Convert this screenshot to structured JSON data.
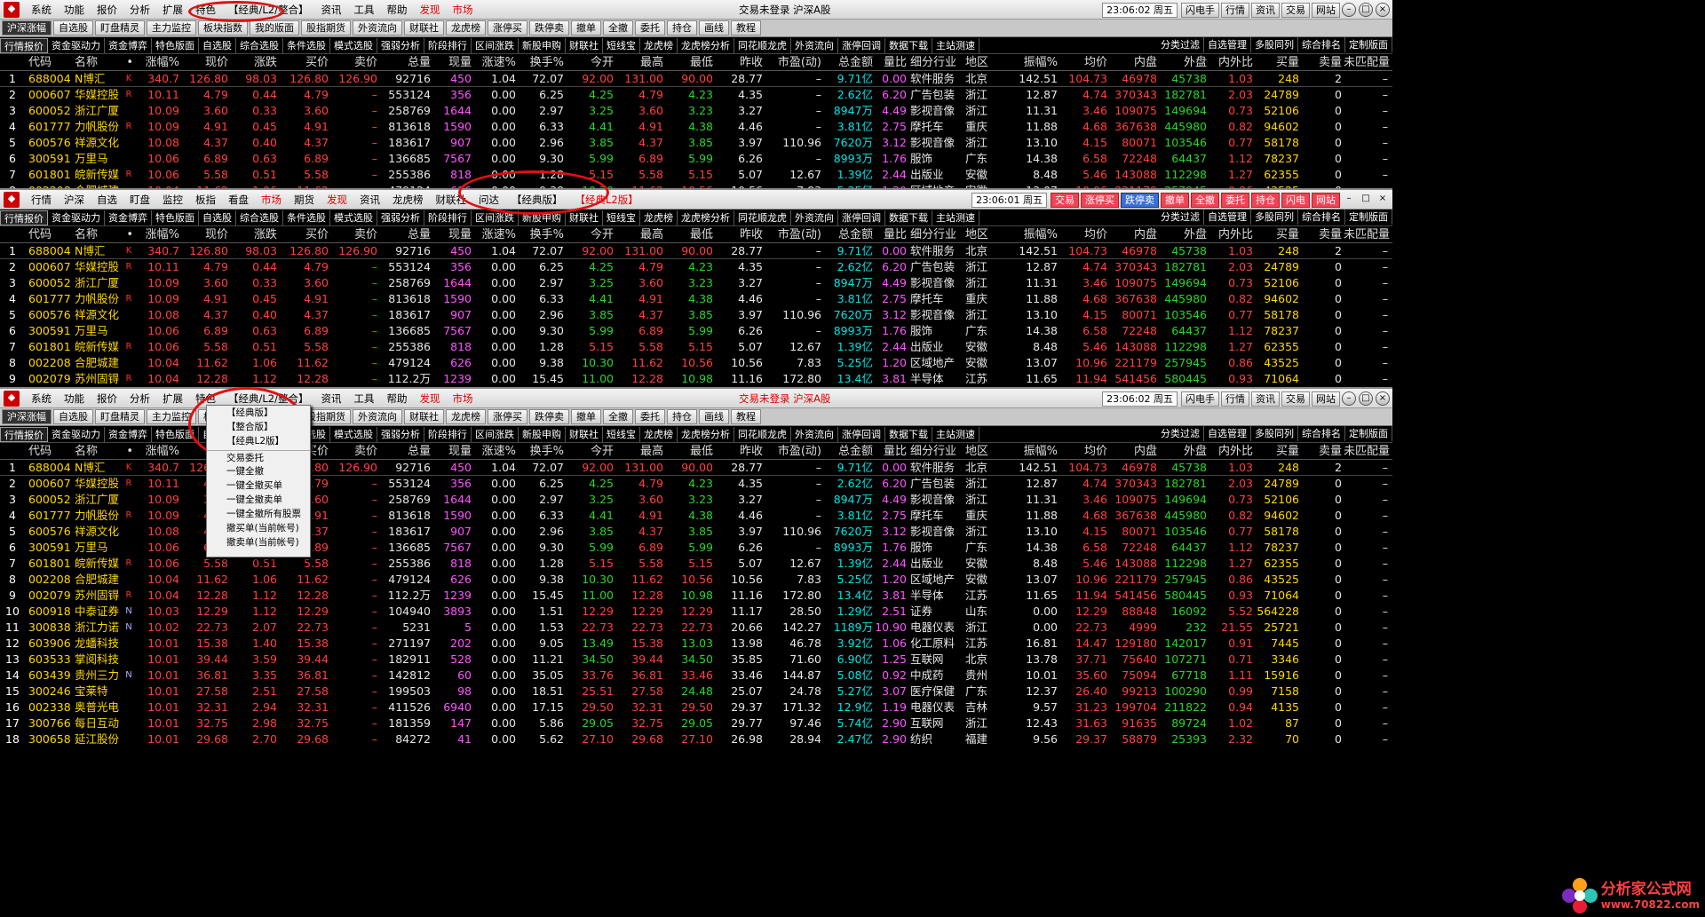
{
  "menu1": {
    "items": [
      "系统",
      "功能",
      "报价",
      "分析",
      "扩展",
      "特色",
      "【经典/L2/整合】",
      "资讯",
      "工具",
      "帮助",
      "发现",
      "市场"
    ],
    "status": "交易未登录  沪深A股",
    "clock": "23:06:02 周五",
    "right_buttons": [
      "闪电手",
      "行情",
      "资讯",
      "交易",
      "网站"
    ]
  },
  "toolbar1": [
    "沪深涨幅",
    "自选股",
    "盯盘精灵",
    "主力监控",
    "板块指数",
    "我的版面",
    "股指期货",
    "外资流向",
    "财联社",
    "龙虎榜",
    "涨停买",
    "跌停卖",
    "撤单",
    "全撤",
    "委托",
    "持仓",
    "画线",
    "教程"
  ],
  "subtabs": [
    "行情报价",
    "资金驱动力",
    "资金博弈",
    "特色版面",
    "自选股",
    "综合选股",
    "条件选股",
    "模式选股",
    "强弱分析",
    "阶段排行",
    "区间涨跌",
    "新股申购",
    "财联社",
    "短线宝",
    "龙虎榜",
    "龙虎榜分析",
    "同花顺龙虎",
    "外资流向",
    "涨停回调",
    "数据下载",
    "主站测速"
  ],
  "subtabs_right": [
    "分类过滤",
    "自选管理",
    "多股同列",
    "综合排名",
    "定制版面"
  ],
  "menu2": {
    "items": [
      "行情",
      "沪深",
      "自选",
      "盯盘",
      "监控",
      "板指",
      "看盘",
      "市场",
      "期货",
      "发现",
      "资讯",
      "龙虎榜",
      "财联社",
      "问达",
      "【经典版】",
      "【经典L2版】"
    ],
    "clock": "23:06:01 周五",
    "right_buttons": [
      "交易",
      "涨停买",
      "跌停卖",
      "撤单",
      "全撤",
      "委托",
      "持仓",
      "闪电",
      "网站"
    ]
  },
  "toolbar3": [
    "沪深涨幅",
    "自选股",
    "盯盘精灵",
    "主力监控",
    "板块指数",
    "我的版面",
    "股指期货",
    "外资流向",
    "财联社",
    "龙虎榜",
    "涨停买",
    "跌停卖",
    "撤单",
    "全撤",
    "委托",
    "持仓",
    "画线",
    "教程"
  ],
  "dropdown": {
    "items": [
      "【经典版】",
      "【整合版】",
      "【经典L2版】",
      "交易委托",
      "一键全撤",
      "一键全撤买单",
      "一键全撤卖单",
      "一键全撤所有股票",
      "撤买单(当前帐号)",
      "撤卖单(当前帐号)"
    ]
  },
  "table": {
    "headers": [
      "",
      "代码",
      "名称",
      "•",
      "涨幅%",
      "现价",
      "涨跌",
      "买价",
      "卖价",
      "总量",
      "现量",
      "涨速%",
      "换手%",
      "今开",
      "最高",
      "最低",
      "昨收",
      "市盈(动)",
      "总金额",
      "量比",
      "细分行业",
      "地区",
      "振幅%",
      "均价",
      "内盘",
      "外盘",
      "内外比",
      "买量",
      "卖量",
      "未匹配量"
    ],
    "rows": [
      [
        "1",
        "688004",
        "N博汇",
        "K",
        "340.7",
        "126.80",
        "98.03",
        "126.80",
        "126.90",
        "92716",
        "450",
        "1.04",
        "72.07",
        "92.00",
        "131.00",
        "90.00",
        "28.77",
        "–",
        "9.71亿",
        "0.00",
        "软件服务",
        "北京",
        "142.51",
        "104.73",
        "46978",
        "45738",
        "1.03",
        "248",
        "2",
        "–"
      ],
      [
        "2",
        "000607",
        "华媒控股",
        "R",
        "10.11",
        "4.79",
        "0.44",
        "4.79",
        "–",
        "553124",
        "356",
        "0.00",
        "6.25",
        "4.25",
        "4.79",
        "4.23",
        "4.35",
        "–",
        "2.62亿",
        "6.20",
        "广告包装",
        "浙江",
        "12.87",
        "4.74",
        "370343",
        "182781",
        "2.03",
        "24789",
        "0",
        "–"
      ],
      [
        "3",
        "600052",
        "浙江广厦",
        "",
        "10.09",
        "3.60",
        "0.33",
        "3.60",
        "–",
        "258769",
        "1644",
        "0.00",
        "2.97",
        "3.25",
        "3.60",
        "3.23",
        "3.27",
        "–",
        "8947万",
        "4.49",
        "影视音像",
        "浙江",
        "11.31",
        "3.46",
        "109075",
        "149694",
        "0.73",
        "52106",
        "0",
        "–"
      ],
      [
        "4",
        "601777",
        "力帆股份",
        "R",
        "10.09",
        "4.91",
        "0.45",
        "4.91",
        "–",
        "813618",
        "1590",
        "0.00",
        "6.33",
        "4.41",
        "4.91",
        "4.38",
        "4.46",
        "–",
        "3.81亿",
        "2.75",
        "摩托车",
        "重庆",
        "11.88",
        "4.68",
        "367638",
        "445980",
        "0.82",
        "94602",
        "0",
        "–"
      ],
      [
        "5",
        "600576",
        "祥源文化",
        "",
        "10.08",
        "4.37",
        "0.40",
        "4.37",
        "–",
        "183617",
        "907",
        "0.00",
        "2.96",
        "3.85",
        "4.37",
        "3.85",
        "3.97",
        "110.96",
        "7620万",
        "3.12",
        "影视音像",
        "浙江",
        "13.10",
        "4.15",
        "80071",
        "103546",
        "0.77",
        "58178",
        "0",
        "–"
      ],
      [
        "6",
        "300591",
        "万里马",
        "",
        "10.06",
        "6.89",
        "0.63",
        "6.89",
        "–",
        "136685",
        "7567",
        "0.00",
        "9.30",
        "5.99",
        "6.89",
        "5.99",
        "6.26",
        "–",
        "8993万",
        "1.76",
        "服饰",
        "广东",
        "14.38",
        "6.58",
        "72248",
        "64437",
        "1.12",
        "78237",
        "0",
        "–"
      ],
      [
        "7",
        "601801",
        "皖新传媒",
        "R",
        "10.06",
        "5.58",
        "0.51",
        "5.58",
        "–",
        "255386",
        "818",
        "0.00",
        "1.28",
        "5.15",
        "5.58",
        "5.15",
        "5.07",
        "12.67",
        "1.39亿",
        "2.44",
        "出版业",
        "安徽",
        "8.48",
        "5.46",
        "143088",
        "112298",
        "1.27",
        "62355",
        "0",
        "–"
      ],
      [
        "8",
        "002208",
        "合肥城建",
        "",
        "10.04",
        "11.62",
        "1.06",
        "11.62",
        "–",
        "479124",
        "626",
        "0.00",
        "9.38",
        "10.30",
        "11.62",
        "10.56",
        "10.56",
        "7.83",
        "5.25亿",
        "1.20",
        "区域地产",
        "安徽",
        "13.07",
        "10.96",
        "221179",
        "257945",
        "0.86",
        "43525",
        "0",
        "–"
      ],
      [
        "9",
        "002079",
        "苏州固锝",
        "R",
        "10.04",
        "12.28",
        "1.12",
        "12.28",
        "–",
        "112.2万",
        "1239",
        "0.00",
        "15.45",
        "11.00",
        "12.28",
        "10.98",
        "11.16",
        "172.80",
        "13.4亿",
        "3.81",
        "半导体",
        "江苏",
        "11.65",
        "11.94",
        "541456",
        "580445",
        "0.93",
        "71064",
        "0",
        "–"
      ],
      [
        "10",
        "600918",
        "中泰证券",
        "N",
        "10.03",
        "12.29",
        "1.12",
        "12.29",
        "–",
        "104940",
        "3893",
        "0.00",
        "1.51",
        "12.29",
        "12.29",
        "12.29",
        "11.17",
        "28.50",
        "1.29亿",
        "2.51",
        "证券",
        "山东",
        "0.00",
        "12.29",
        "88848",
        "16092",
        "5.52",
        "564228",
        "0",
        "–"
      ],
      [
        "11",
        "300838",
        "浙江力诺",
        "N",
        "10.02",
        "22.73",
        "2.07",
        "22.73",
        "–",
        "5231",
        "5",
        "0.00",
        "1.53",
        "22.73",
        "22.73",
        "22.73",
        "20.66",
        "142.27",
        "1189万",
        "10.90",
        "电器仪表",
        "浙江",
        "0.00",
        "22.73",
        "4999",
        "232",
        "21.55",
        "25721",
        "0",
        "–"
      ],
      [
        "12",
        "603906",
        "龙蟠科技",
        "",
        "10.01",
        "15.38",
        "1.40",
        "15.38",
        "–",
        "271197",
        "202",
        "0.00",
        "9.05",
        "13.49",
        "15.38",
        "13.03",
        "13.98",
        "46.78",
        "3.92亿",
        "1.06",
        "化工原料",
        "江苏",
        "16.81",
        "14.47",
        "129180",
        "142017",
        "0.91",
        "7445",
        "0",
        "–"
      ],
      [
        "13",
        "603533",
        "掌阅科技",
        "",
        "10.01",
        "39.44",
        "3.59",
        "39.44",
        "–",
        "182911",
        "528",
        "0.00",
        "11.21",
        "34.50",
        "39.44",
        "34.50",
        "35.85",
        "71.60",
        "6.90亿",
        "1.25",
        "互联网",
        "北京",
        "13.78",
        "37.71",
        "75640",
        "107271",
        "0.71",
        "3346",
        "0",
        "–"
      ],
      [
        "14",
        "603439",
        "贵州三力",
        "N",
        "10.01",
        "36.81",
        "3.35",
        "36.81",
        "–",
        "142812",
        "60",
        "0.00",
        "35.05",
        "33.76",
        "36.81",
        "33.46",
        "33.46",
        "144.87",
        "5.08亿",
        "0.92",
        "中成药",
        "贵州",
        "10.01",
        "35.60",
        "75094",
        "67718",
        "1.11",
        "15916",
        "0",
        "–"
      ],
      [
        "15",
        "300246",
        "宝莱特",
        "",
        "10.01",
        "27.58",
        "2.51",
        "27.58",
        "–",
        "199503",
        "98",
        "0.00",
        "18.51",
        "25.51",
        "27.58",
        "24.48",
        "25.07",
        "24.78",
        "5.27亿",
        "3.07",
        "医疗保健",
        "广东",
        "12.37",
        "26.40",
        "99213",
        "100290",
        "0.99",
        "7158",
        "0",
        "–"
      ],
      [
        "16",
        "002338",
        "奥普光电",
        "",
        "10.01",
        "32.31",
        "2.94",
        "32.31",
        "–",
        "411526",
        "6940",
        "0.00",
        "17.15",
        "29.50",
        "32.31",
        "29.50",
        "29.37",
        "171.32",
        "12.9亿",
        "1.19",
        "电器仪表",
        "吉林",
        "9.57",
        "31.23",
        "199704",
        "211822",
        "0.94",
        "4135",
        "0",
        "–"
      ],
      [
        "17",
        "300766",
        "每日互动",
        "",
        "10.01",
        "32.75",
        "2.98",
        "32.75",
        "–",
        "181359",
        "147",
        "0.00",
        "5.86",
        "29.05",
        "32.75",
        "29.05",
        "29.77",
        "97.46",
        "5.74亿",
        "2.90",
        "互联网",
        "浙江",
        "12.43",
        "31.63",
        "91635",
        "89724",
        "1.02",
        "87",
        "0",
        "–"
      ],
      [
        "18",
        "300658",
        "延江股份",
        "",
        "10.01",
        "29.68",
        "2.70",
        "29.68",
        "–",
        "84272",
        "41",
        "0.00",
        "5.62",
        "27.10",
        "29.68",
        "27.10",
        "26.98",
        "28.94",
        "2.47亿",
        "2.90",
        "纺织",
        "福建",
        "9.56",
        "29.37",
        "58879",
        "25393",
        "2.32",
        "70",
        "0",
        "–"
      ]
    ]
  },
  "watermark": {
    "title": "分析家公式网",
    "url": "www.70822.com"
  },
  "colors": {
    "up": "#ff4040",
    "down": "#2bd52b",
    "code": "#ffd700",
    "circle": "#e01010"
  }
}
